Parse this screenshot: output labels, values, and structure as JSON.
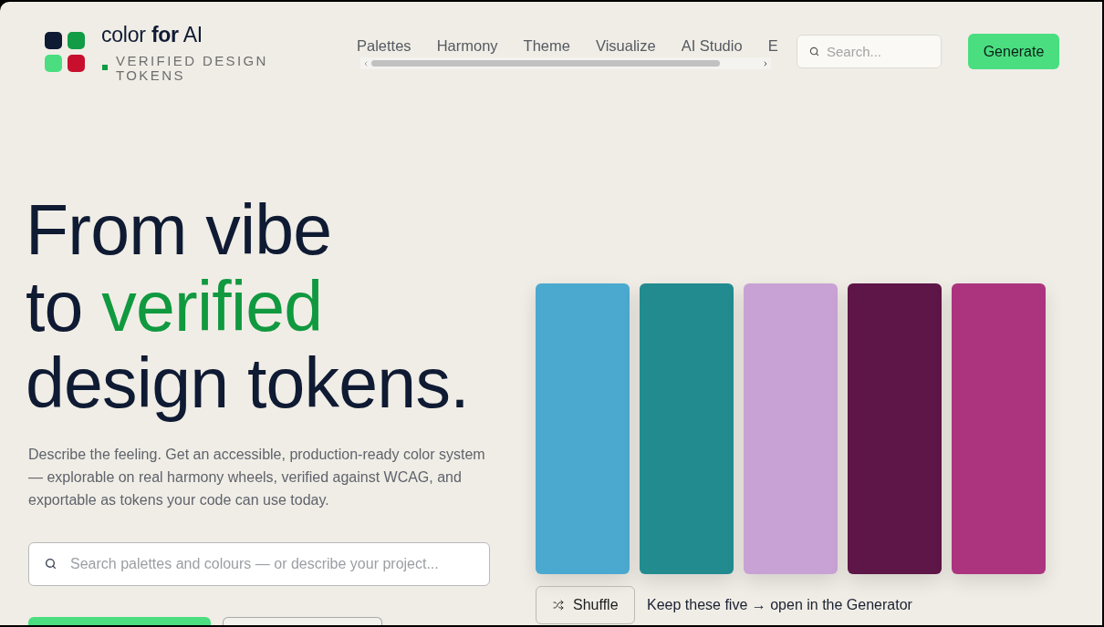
{
  "header": {
    "brand": {
      "name": "color **for** AI",
      "tagline": "VERIFIED DESIGN TOKENS"
    },
    "nav": {
      "items": [
        {
          "label": "Palettes"
        },
        {
          "label": "Harmony"
        },
        {
          "label": "Theme"
        },
        {
          "label": "Visualize"
        },
        {
          "label": "AI Studio"
        },
        {
          "label": "E"
        }
      ]
    },
    "search": {
      "placeholder": "Search..."
    },
    "generate_button": {
      "label": "Generate"
    }
  },
  "hero": {
    "headline": {
      "lines": [
        {
          "parts": [
            {
              "text": "From vibe",
              "accent": false
            }
          ]
        },
        {
          "parts": [
            {
              "text": "to",
              "accent": false
            },
            {
              "text": "verified",
              "accent": true
            }
          ]
        },
        {
          "parts": [
            {
              "text": "design tokens.",
              "accent": false
            }
          ]
        }
      ]
    },
    "description": "Describe the feeling. Get an accessible, production-ready color system — explorable on real harmony wheels, verified against WCAG, and exportable as tokens your code can use today.",
    "search": {
      "placeholder": "Search palettes and colours — or describe your project..."
    },
    "actions": [
      {
        "kind": "primary"
      },
      {
        "kind": "secondary"
      }
    ]
  },
  "palette": {
    "swatches": [
      {
        "color": "#4ba9cf"
      },
      {
        "color": "#228b90"
      },
      {
        "color": "#c8a2d4"
      },
      {
        "color": "#5e1547"
      },
      {
        "color": "#ac347e"
      }
    ],
    "shuffle_button": {
      "label": "Shuffle"
    },
    "hint": "Keep these five → open in the Generator"
  }
}
